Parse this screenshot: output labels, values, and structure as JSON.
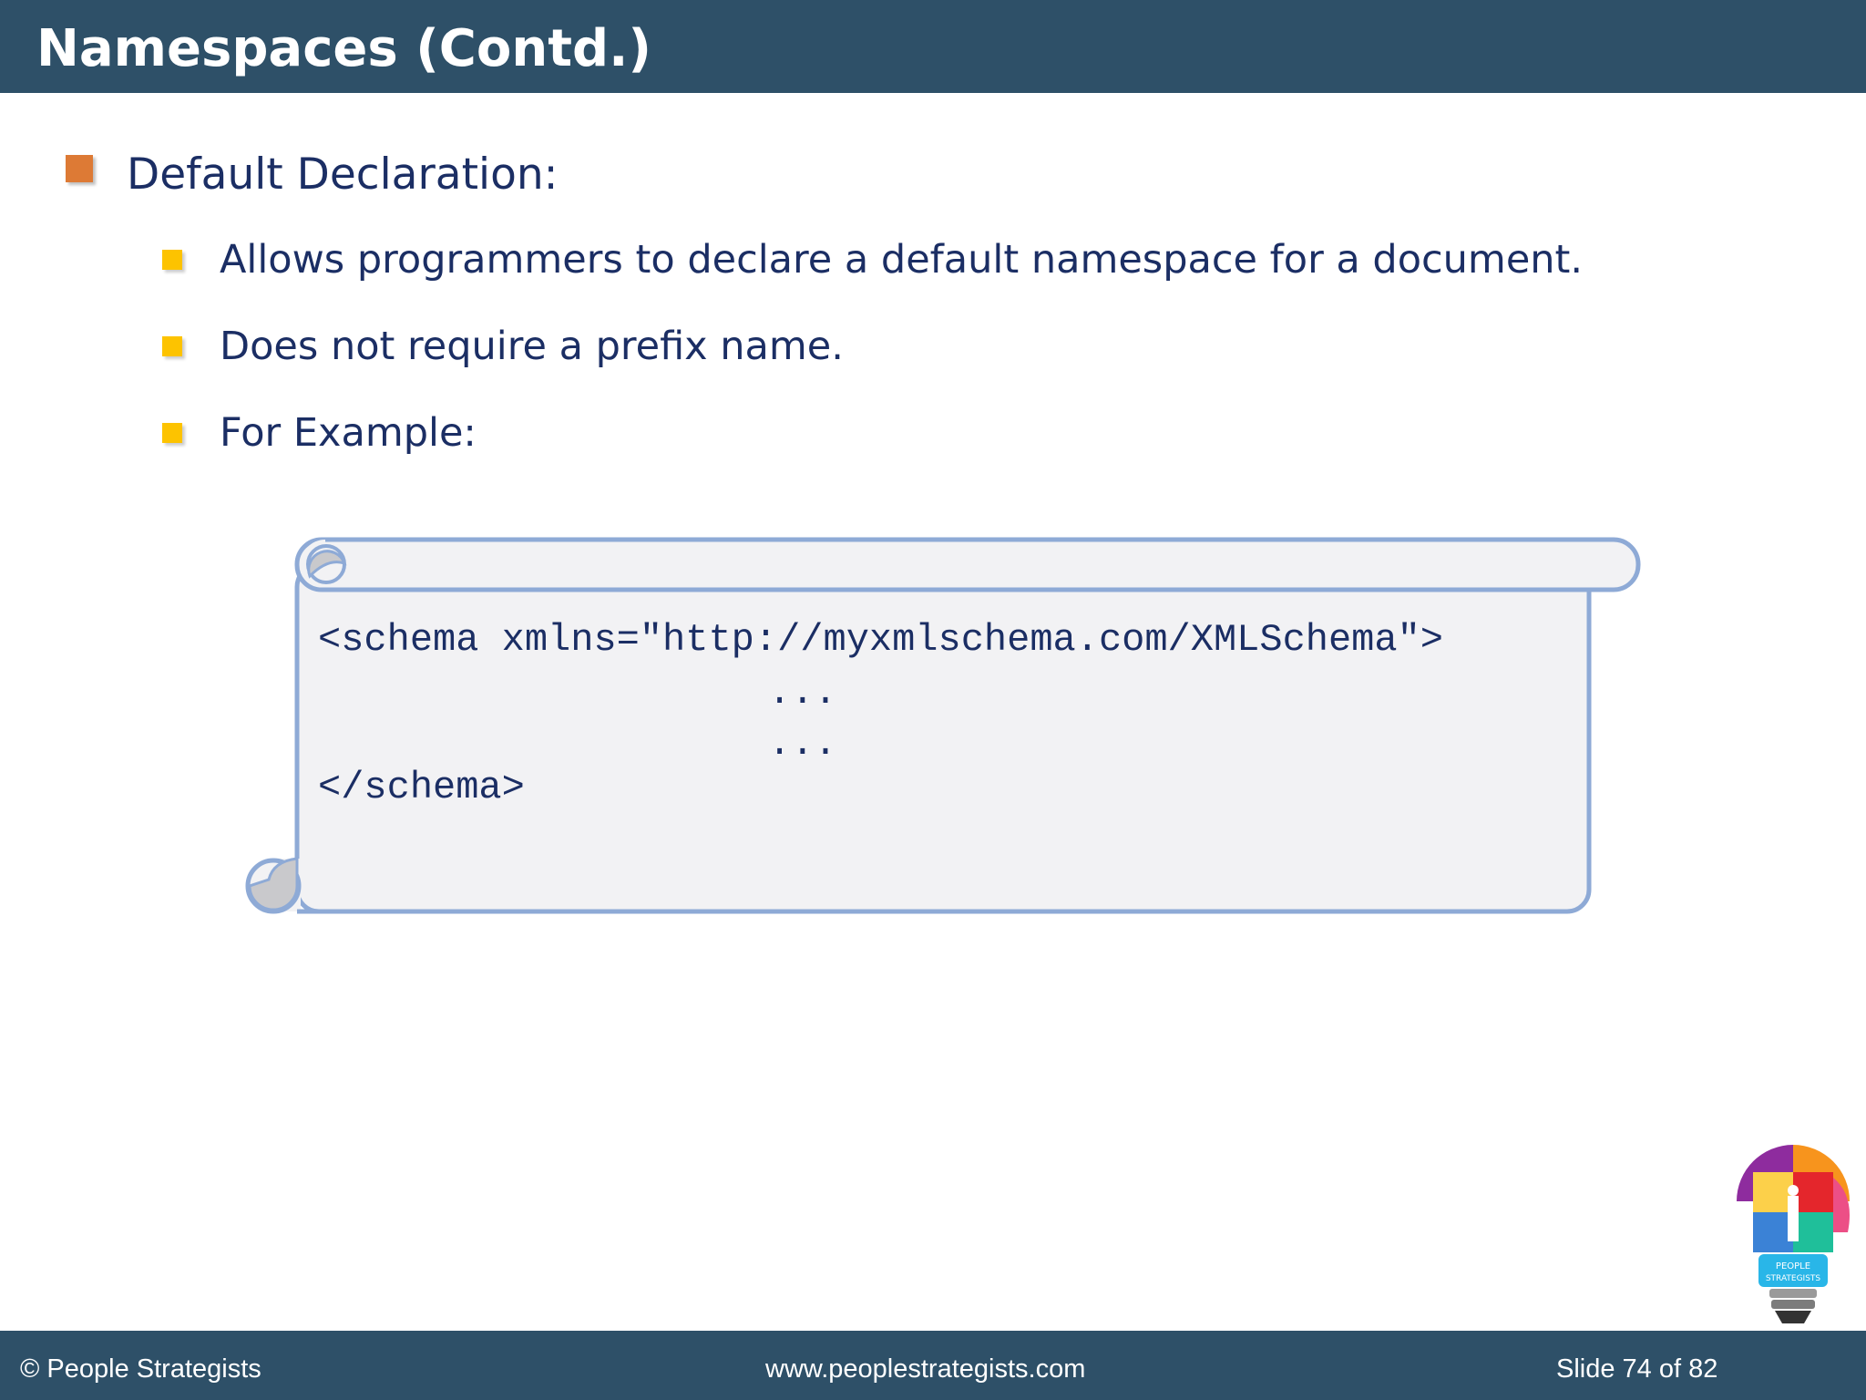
{
  "slide": {
    "title": "Namespaces (Contd.)"
  },
  "content": {
    "heading": "Default Declaration:",
    "bullets": [
      "Allows programmers to declare a default namespace for a document.",
      "Does not require a prefix name.",
      "For Example:"
    ]
  },
  "code": {
    "lines": [
      "<schema xmlns=\"http://myxmlschema.com/XMLSchema\">",
      "...",
      "...",
      "</schema>"
    ]
  },
  "footer": {
    "copyright": "© People Strategists",
    "website": "www.peoplestrategists.com",
    "slide_counter": "Slide 74 of 82"
  },
  "logo": {
    "text_line1": "PEOPLE",
    "text_line2": "STRATEGISTS"
  },
  "colors": {
    "header_bg": "#2e5068",
    "text": "#1b2e64",
    "bullet_primary": "#dd7a35",
    "bullet_secondary": "#fdc300",
    "scroll_fill": "#f2f2f4",
    "scroll_border": "#8eaad6"
  }
}
